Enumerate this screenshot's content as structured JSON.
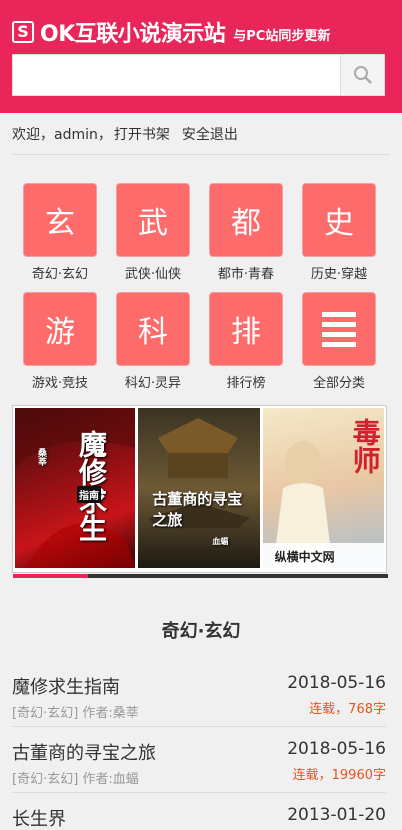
{
  "header": {
    "logo_letter": "S",
    "title": "OK互联小说演示站",
    "subtitle": "与PC站同步更新",
    "bg_color": "#e8265a"
  },
  "search": {
    "value": "",
    "placeholder": "",
    "button_icon": "search-icon"
  },
  "userbar": {
    "welcome": "欢迎，admin，",
    "bookshelf": "打开书架",
    "logout": "安全退出"
  },
  "categories": [
    {
      "glyph": "玄",
      "label": "奇幻·玄幻"
    },
    {
      "glyph": "武",
      "label": "武侠·仙侠"
    },
    {
      "glyph": "都",
      "label": "都市·青春"
    },
    {
      "glyph": "史",
      "label": "历史·穿越"
    },
    {
      "glyph": "游",
      "label": "游戏·竞技"
    },
    {
      "glyph": "科",
      "label": "科幻·灵异"
    },
    {
      "glyph": "排",
      "label": "排行榜"
    },
    {
      "glyph": "",
      "label": "全部分类",
      "icon": "menu-icon"
    }
  ],
  "banner": {
    "covers": [
      {
        "title": "魔修求生",
        "sub": "指南",
        "author": "桑莘"
      },
      {
        "title": "古董商的寻宝之旅",
        "author": "血蝠"
      },
      {
        "title": "毒师",
        "sub": "纵横中文网"
      }
    ],
    "progress": 0.2
  },
  "section": {
    "title": "奇幻·玄幻"
  },
  "books": [
    {
      "name": "魔修求生指南",
      "meta": "[奇幻·玄幻] 作者:桑莘",
      "date": "2018-05-16",
      "status": "连载，768字"
    },
    {
      "name": "古董商的寻宝之旅",
      "meta": "[奇幻·玄幻] 作者:血蝠",
      "date": "2018-05-16",
      "status": "连载，19960字"
    },
    {
      "name": "长生界",
      "meta": "",
      "date": "2013-01-20",
      "status": ""
    }
  ]
}
